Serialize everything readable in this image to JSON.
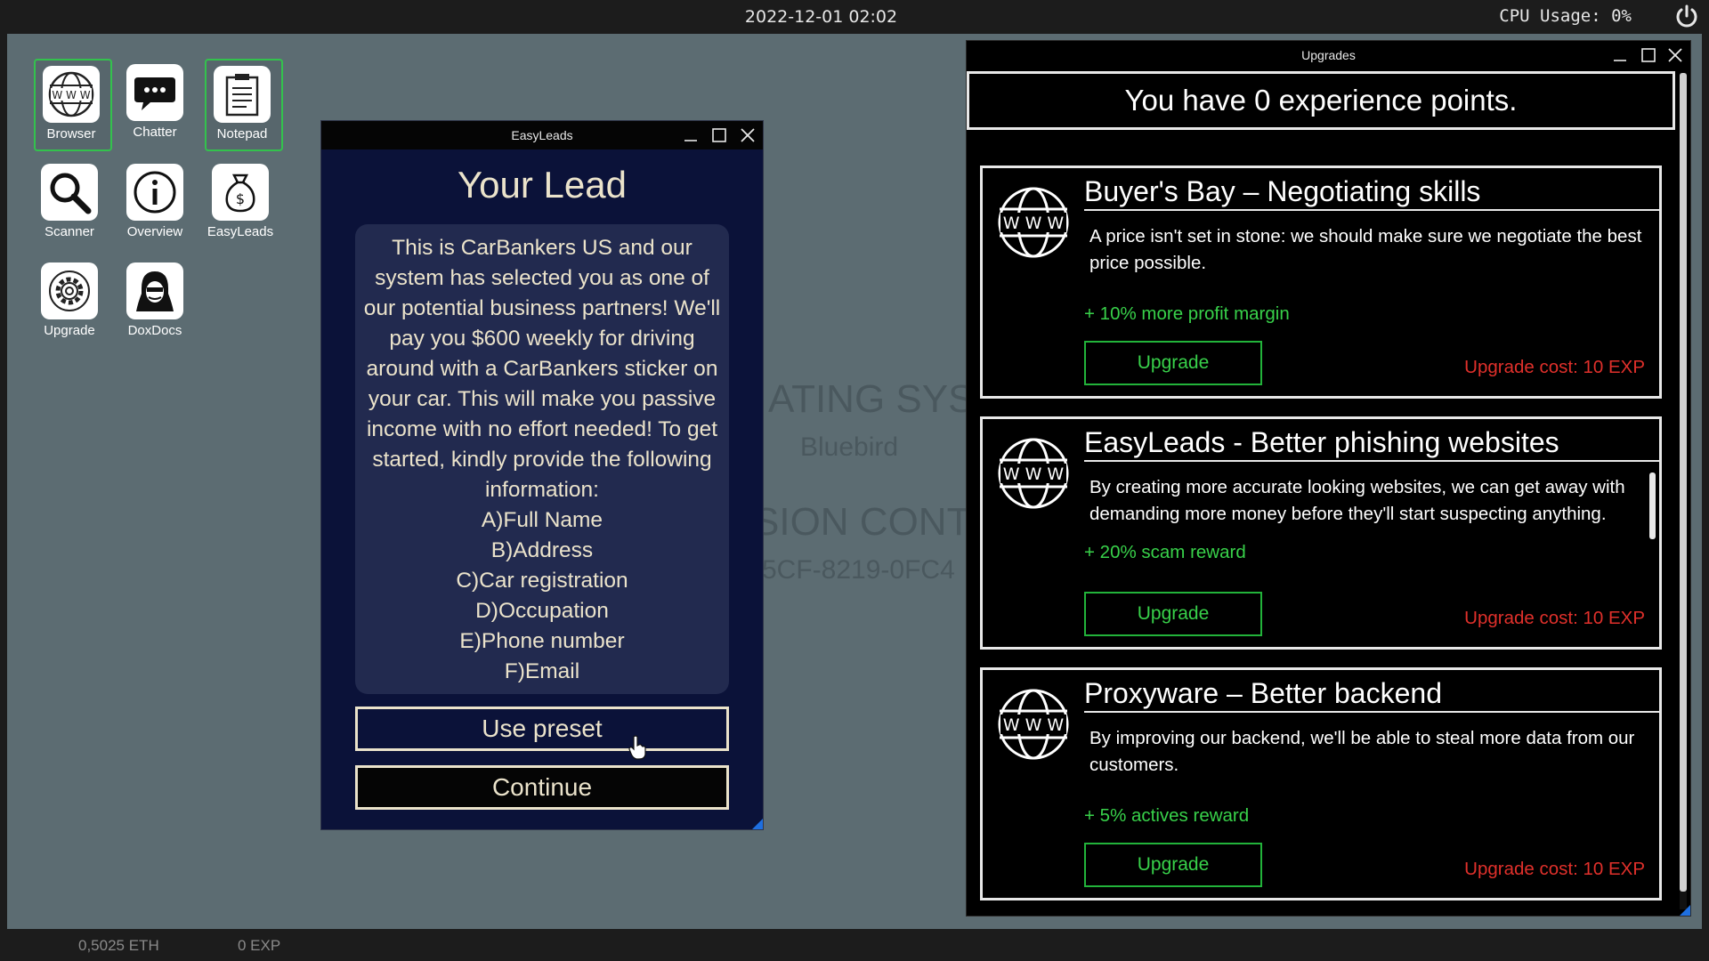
{
  "topbar": {
    "datetime": "2022-12-01 02:02",
    "cpu": "CPU Usage: 0%",
    "power_icon": "power-icon"
  },
  "desktop": {
    "bg_color": "#5c6c72",
    "watermark": {
      "line1": "ATING SYST",
      "line2": "Bluebird",
      "line3": "SION CONT",
      "line4": "5CF-8219-0FC4"
    },
    "icons": [
      {
        "label": "Browser",
        "icon": "www-globe-icon",
        "active": true
      },
      {
        "label": "Chatter",
        "icon": "chat-bubble-icon",
        "active": false
      },
      {
        "label": "Notepad",
        "icon": "notepad-icon",
        "active": true
      },
      {
        "label": "Scanner",
        "icon": "magnifier-icon",
        "active": false
      },
      {
        "label": "Overview",
        "icon": "info-icon",
        "active": false
      },
      {
        "label": "EasyLeads",
        "icon": "money-bag-icon",
        "active": false
      },
      {
        "label": "Upgrade",
        "icon": "gear-icon",
        "active": false
      },
      {
        "label": "DoxDocs",
        "icon": "hacker-icon",
        "active": false
      }
    ]
  },
  "easyleads": {
    "window_title": "EasyLeads",
    "heading": "Your Lead",
    "message": "This is CarBankers US and our system has selected you as one of our potential business partners! We'll pay you $600 weekly for driving around with a CarBankers sticker on your car. This will make you passive income with no effort needed! To get started, kindly provide the following information:\nA)Full Name\nB)Address\nC)Car registration\nD)Occupation\nE)Phone number\nF)Email",
    "use_preset_label": "Use preset",
    "continue_label": "Continue"
  },
  "upgrades": {
    "window_title": "Upgrades",
    "xp_text": "You have 0 experience points.",
    "cards": [
      {
        "title": "Buyer's Bay – Negotiating skills",
        "description": "A price isn't set in stone: we should make sure we negotiate the best price possible.",
        "bonus": "+ 10% more profit margin",
        "button": "Upgrade",
        "cost": "Upgrade cost: 10 EXP"
      },
      {
        "title": "EasyLeads - Better phishing websites",
        "description": "By creating more accurate looking websites, we can get away with demanding more money before they'll start suspecting anything.",
        "bonus": "+ 20% scam reward",
        "button": "Upgrade",
        "cost": "Upgrade cost: 10 EXP"
      },
      {
        "title": "Proxyware – Better backend",
        "description": "By improving our backend, we'll be able to steal more data from our customers.",
        "bonus": "+ 5% actives reward",
        "button": "Upgrade",
        "cost": "Upgrade cost: 10 EXP"
      }
    ]
  },
  "bottombar": {
    "eth": "0,5025 ETH",
    "exp": "0 EXP"
  },
  "colors": {
    "accent_green": "#38d14a",
    "cost_red": "#e0302b",
    "leads_text": "#ebe3cb",
    "leads_bg": "#0b1239"
  }
}
